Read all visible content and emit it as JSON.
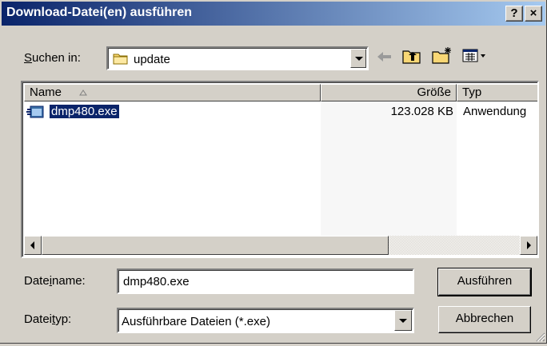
{
  "window": {
    "title": "Download-Datei(en) ausführen",
    "help_button": "?",
    "close_button": "×"
  },
  "look_in": {
    "label": "Suchen in:",
    "value": "update"
  },
  "toolbar": {
    "back_icon": "back-arrow-icon",
    "up_icon": "up-folder-icon",
    "new_folder_icon": "new-folder-icon",
    "view_icon": "view-menu-icon"
  },
  "file_list": {
    "columns": [
      "Name",
      "Größe",
      "Typ"
    ],
    "files": [
      {
        "name": "dmp480.exe",
        "size": "123.028 KB",
        "type": "Anwendung"
      }
    ]
  },
  "filename": {
    "label": "Dateiname:",
    "value": "dmp480.exe"
  },
  "filetype": {
    "label": "Dateityp:",
    "value": "Ausführbare Dateien (*.exe)"
  },
  "buttons": {
    "run": "Ausführen",
    "cancel": "Abbrechen"
  },
  "colors": {
    "title_start": "#0a246a",
    "title_end": "#a6caf0",
    "face": "#d4d0c8",
    "selection": "#0a246a"
  }
}
